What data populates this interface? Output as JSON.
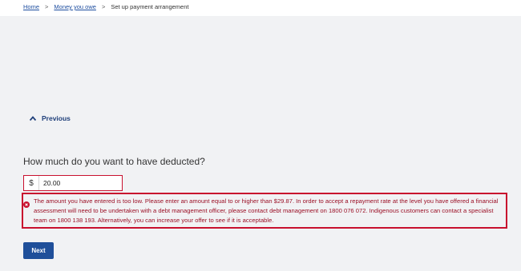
{
  "breadcrumb": {
    "items": [
      "Home",
      "Money you owe",
      "Set up payment arrangement"
    ],
    "separator": ">"
  },
  "previous": {
    "label": "Previous",
    "icon": "chevron-up-icon"
  },
  "question": "How much do you want to have deducted?",
  "amount": {
    "currency_symbol": "$",
    "value": "20.00"
  },
  "error": {
    "icon": "error-icon",
    "message": "The amount you have entered is too low. Please enter an amount equal to or higher than $29.87. In order to accept a repayment rate at the level you have offered a financial assessment will need to be undertaken with a debt management officer, please contact debt management on 1800 076 072. Indigenous customers can contact a specialist team on 1800 138 193. Alternatively, you can increase your offer to see if it is acceptable."
  },
  "next_button": {
    "label": "Next"
  },
  "colors": {
    "link": "#1f4fa0",
    "error": "#c8102e",
    "error_text": "#9b1026",
    "primary_button": "#1f4f9a",
    "background": "#f1f2f4"
  }
}
